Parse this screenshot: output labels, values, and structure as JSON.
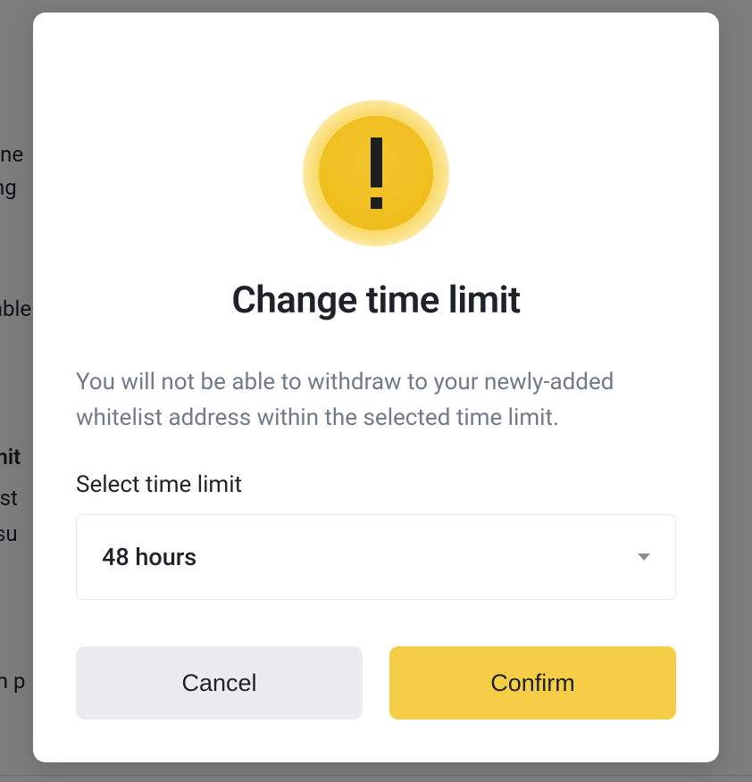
{
  "background": {
    "frag1": "rne\nng",
    "frag2": "able",
    "frag3": "mit",
    "frag4": "list",
    "frag5": " su",
    "frag6": "m p"
  },
  "modal": {
    "title": "Change time limit",
    "description": "You will not be able to withdraw to your newly-added whitelist address within the selected time limit.",
    "field_label": "Select time limit",
    "selected_value": "48 hours",
    "cancel_label": "Cancel",
    "confirm_label": "Confirm"
  }
}
